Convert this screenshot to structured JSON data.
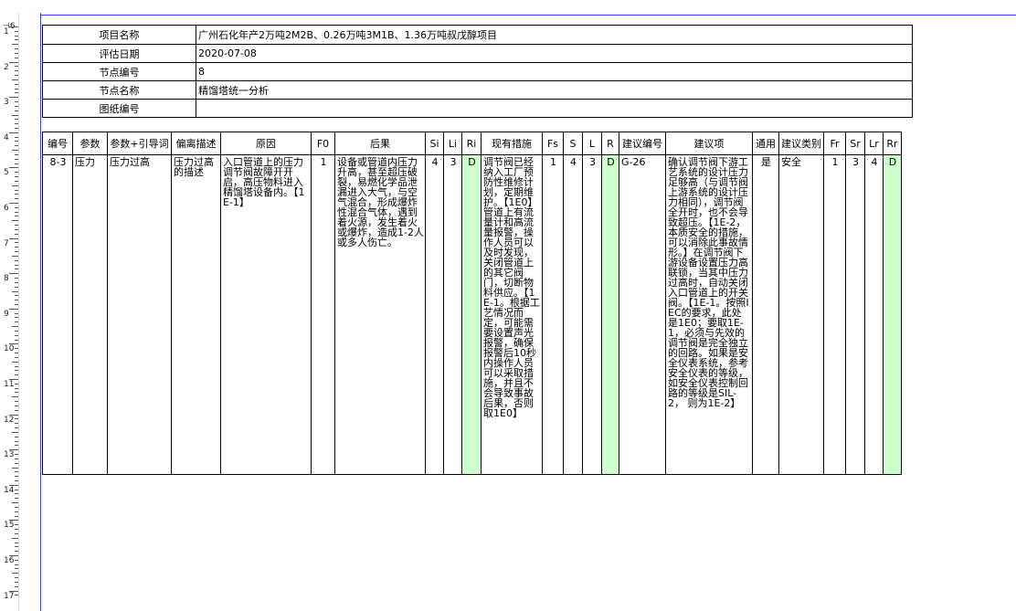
{
  "ruler": {
    "numbers": [
      "1",
      "2",
      "3",
      "4",
      "5",
      "6",
      "7",
      "8",
      "9",
      "10",
      "11",
      "12",
      "13",
      "14",
      "15",
      "16",
      "17"
    ],
    "cursor": "⊣6"
  },
  "info": {
    "rows": [
      {
        "label": "项目名称",
        "value": "广州石化年产2万吨2M2B、0.26万吨3M1B、1.36万吨叔戊醇项目"
      },
      {
        "label": "评估日期",
        "value": "2020-07-08"
      },
      {
        "label": "节点编号",
        "value": "8"
      },
      {
        "label": "节点名称",
        "value": "精馏塔统一分析"
      },
      {
        "label": "图纸编号",
        "value": ""
      }
    ]
  },
  "table": {
    "headers": [
      "编号",
      "参数",
      "参数+引导词",
      "偏离描述",
      "原因",
      "F0",
      "后果",
      "Si",
      "Li",
      "Ri",
      "现有措施",
      "Fs",
      "S",
      "L",
      "R",
      "建议编号",
      "建议项",
      "通用",
      "建议类别",
      "Fr",
      "Sr",
      "Lr",
      "Rr"
    ],
    "row": {
      "id": "8-3",
      "param": "压力",
      "param_guide": "压力过高",
      "deviation": "压力过高的描述",
      "cause": "入口管道上的压力调节阀故障开开启，高压物料进入精馏塔设备内。【1E-1】",
      "f0": "1",
      "consequence": "设备或管道内压力升高，甚至超压破裂，易燃化学品泄漏进入大气，与空气混合，形成爆炸性混合气体，遇到着火源，发生着火或爆炸，造成1-2人或多人伤亡。",
      "si": "4",
      "li": "3",
      "ri": "D",
      "measures": "调节阀已经纳入工厂预防性维修计划，定期维护。【1E0】管道上有流量计和高流量报警，操作人员可以及时发现，关闭管道上的其它阀门，切断物料供应。【1E-1。根据工艺情况而定，可能需要设置声光报警，确保报警后10秒内操作人员可以采取措施，并且不会导致事故后果，否则取1E0】",
      "fs": "1",
      "s": "4",
      "l": "3",
      "r": "D",
      "suggestion_id": "G-26",
      "suggestion": "确认调节阀下游工艺系统的设计压力足够高（与调节阀上游系统的设计压力相同），调节阀全开时，也不会导致超压。【1E-2，本质安全的措施，可以消除此事故情形。】在调节阀下游设备设置压力高联锁，当其中压力过高时，自动关闭入口管道上的开关阀。【1E-1。按照IEC的要求，此处是1E0；要取1E-1，必须与先效的调节阀是完全独立的回路。如果是安全仪表系统，参考安全仪表的等级，如安全仪表控制回路的等级是SIL-2，  则为1E-2】",
      "general": "是",
      "category": "安全",
      "fr": "1",
      "sr": "3",
      "lr": "4",
      "rr": "D"
    }
  },
  "colors": {
    "risk_cell_bg": "#ccffcc",
    "page_edge": "#3a3aff"
  }
}
